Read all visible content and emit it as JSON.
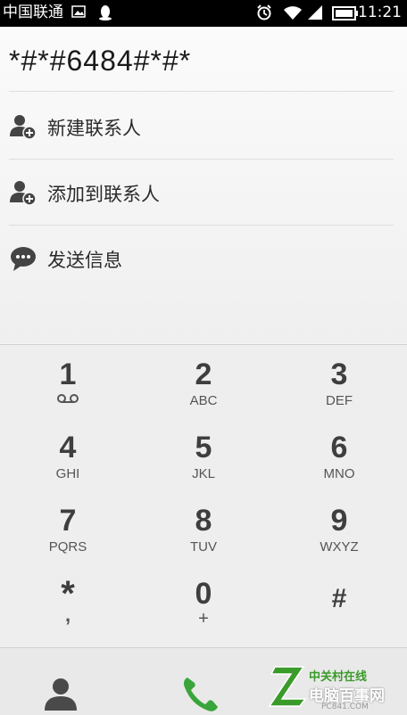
{
  "status_bar": {
    "carrier": "中国联通",
    "time": "11:21",
    "icons": [
      "image-notification-icon",
      "qq-notification-icon",
      "alarm-icon",
      "wifi-icon",
      "signal-icon",
      "battery-icon"
    ]
  },
  "dialer": {
    "number": "*#*#6484#*#*",
    "actions": [
      {
        "label": "新建联系人",
        "icon": "add-contact-icon"
      },
      {
        "label": "添加到联系人",
        "icon": "add-to-contact-icon"
      },
      {
        "label": "发送信息",
        "icon": "message-icon"
      }
    ]
  },
  "keypad": {
    "keys": [
      {
        "digit": "1",
        "letters": ""
      },
      {
        "digit": "2",
        "letters": "ABC"
      },
      {
        "digit": "3",
        "letters": "DEF"
      },
      {
        "digit": "4",
        "letters": "GHI"
      },
      {
        "digit": "5",
        "letters": "JKL"
      },
      {
        "digit": "6",
        "letters": "MNO"
      },
      {
        "digit": "7",
        "letters": "PQRS"
      },
      {
        "digit": "8",
        "letters": "TUV"
      },
      {
        "digit": "9",
        "letters": "WXYZ"
      },
      {
        "digit": "*",
        "letters": ","
      },
      {
        "digit": "0",
        "letters": "+"
      },
      {
        "digit": "#",
        "letters": ""
      }
    ]
  },
  "bottom_bar": {
    "buttons": [
      "contacts-icon",
      "call-icon"
    ]
  },
  "watermark": {
    "line1": "中关村在线",
    "line2": "电脑百事网",
    "line3": "PC841.COM"
  },
  "colors": {
    "call_green": "#3aa53a",
    "status_bg": "#000000",
    "accent_text": "#3e3e3e"
  }
}
